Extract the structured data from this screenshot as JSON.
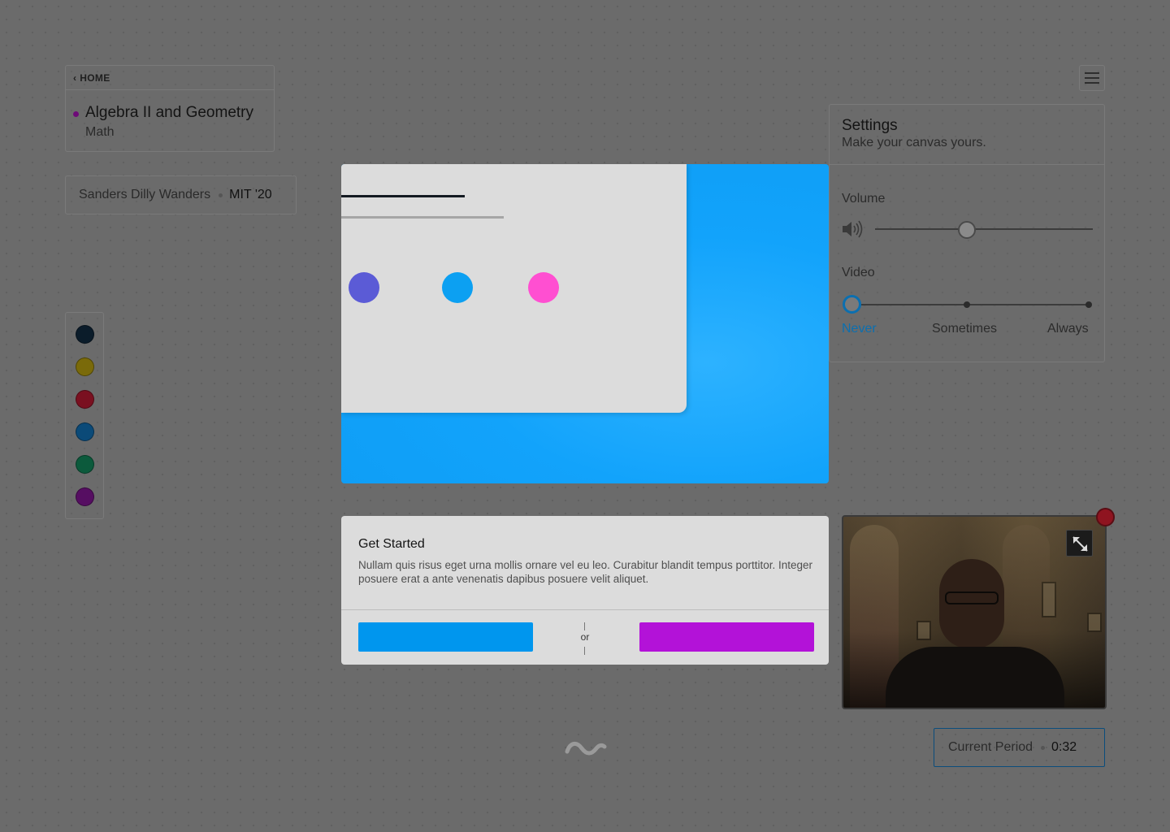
{
  "class_card": {
    "home_label": "HOME",
    "course_title": "Algebra II and Geometry",
    "course_subject": "Math",
    "course_dot_color": "#6e0a78"
  },
  "user_card": {
    "name": "Sanders Dilly Wanders",
    "school": "MIT '20"
  },
  "palette": {
    "colors": [
      "#0b1c2a",
      "#7a6a0a",
      "#7a1020",
      "#0b4a78",
      "#0c5a3c",
      "#560e62"
    ],
    "icon_names": [
      "swatch-navy",
      "swatch-yellow",
      "swatch-red",
      "swatch-blue",
      "swatch-green",
      "swatch-purple"
    ]
  },
  "hero": {
    "background_color": "#0d9cf4",
    "dot_colors": [
      "#5b5bd6",
      "#0ca0f2",
      "#ff4fd1"
    ]
  },
  "settings": {
    "title": "Settings",
    "subtitle": "Make your canvas yours.",
    "volume_label": "Volume",
    "volume_level": 0.42,
    "video_label": "Video",
    "video_options": [
      "Never",
      "Sometimes",
      "Always"
    ],
    "video_selected": "Never",
    "selected_color": "#0b6fb0"
  },
  "get_started": {
    "title": "Get Started",
    "description": "Nullam quis risus eget urna mollis ornare vel eu leo. Curabitur blandit tempus porttitor. Integer posuere erat a ante venenatis dapibus posuere velit aliquet.",
    "or_label": "or",
    "primary_button_color": "#0096ee",
    "secondary_button_color": "#b312d8"
  },
  "period": {
    "label": "Current Period",
    "time": "0:32"
  },
  "icons": {
    "menu": "hamburger-menu-icon",
    "volume": "speaker-icon",
    "expand": "expand-icon",
    "record": "record-dot-icon",
    "logo": "wave-logo-icon",
    "back": "chevron-left-icon"
  }
}
